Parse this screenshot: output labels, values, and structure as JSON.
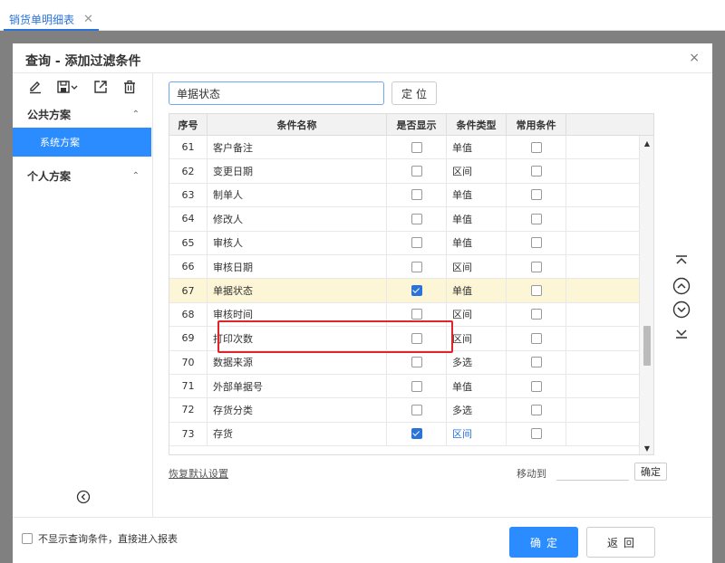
{
  "app": {
    "tab_label": "销货单明细表",
    "tab_close": "✕"
  },
  "dialog": {
    "title": "查询 - 添加过滤条件",
    "close": "×"
  },
  "sidebar": {
    "public_group": "公共方案",
    "public_item": "系统方案",
    "personal_group": "个人方案",
    "chevron_up": "⌃"
  },
  "search": {
    "value": "单据状态",
    "locate_label": "定位"
  },
  "table": {
    "headers": [
      "序号",
      "条件名称",
      "是否显示",
      "条件类型",
      "常用条件"
    ],
    "rows": [
      {
        "seq": "61",
        "name": "客户备注",
        "show": false,
        "type": "单值",
        "common": false,
        "type_link": false
      },
      {
        "seq": "62",
        "name": "变更日期",
        "show": false,
        "type": "区间",
        "common": false,
        "type_link": false
      },
      {
        "seq": "63",
        "name": "制单人",
        "show": false,
        "type": "单值",
        "common": false,
        "type_link": false
      },
      {
        "seq": "64",
        "name": "修改人",
        "show": false,
        "type": "单值",
        "common": false,
        "type_link": false
      },
      {
        "seq": "65",
        "name": "审核人",
        "show": false,
        "type": "单值",
        "common": false,
        "type_link": false
      },
      {
        "seq": "66",
        "name": "审核日期",
        "show": false,
        "type": "区间",
        "common": false,
        "type_link": false
      },
      {
        "seq": "67",
        "name": "单据状态",
        "show": true,
        "type": "单值",
        "common": false,
        "type_link": false,
        "selected": true
      },
      {
        "seq": "68",
        "name": "审核时间",
        "show": false,
        "type": "区间",
        "common": false,
        "type_link": false
      },
      {
        "seq": "69",
        "name": "打印次数",
        "show": false,
        "type": "区间",
        "common": false,
        "type_link": false
      },
      {
        "seq": "70",
        "name": "数据来源",
        "show": false,
        "type": "多选",
        "common": false,
        "type_link": false
      },
      {
        "seq": "71",
        "name": "外部单据号",
        "show": false,
        "type": "单值",
        "common": false,
        "type_link": false
      },
      {
        "seq": "72",
        "name": "存货分类",
        "show": false,
        "type": "多选",
        "common": false,
        "type_link": false
      },
      {
        "seq": "73",
        "name": "存货",
        "show": true,
        "type": "区间",
        "common": false,
        "type_link": true
      }
    ]
  },
  "bottom": {
    "restore_default": "恢复默认设置",
    "move_to_label": "移动到",
    "move_to_confirm": "确定"
  },
  "footer": {
    "skip_label": "不显示查询条件，直接进入报表",
    "ok_label": "确定",
    "back_label": "返回"
  },
  "colors": {
    "accent": "#2a8cff",
    "highlight": "#e0252a",
    "selected_row": "#fdf6d6"
  }
}
